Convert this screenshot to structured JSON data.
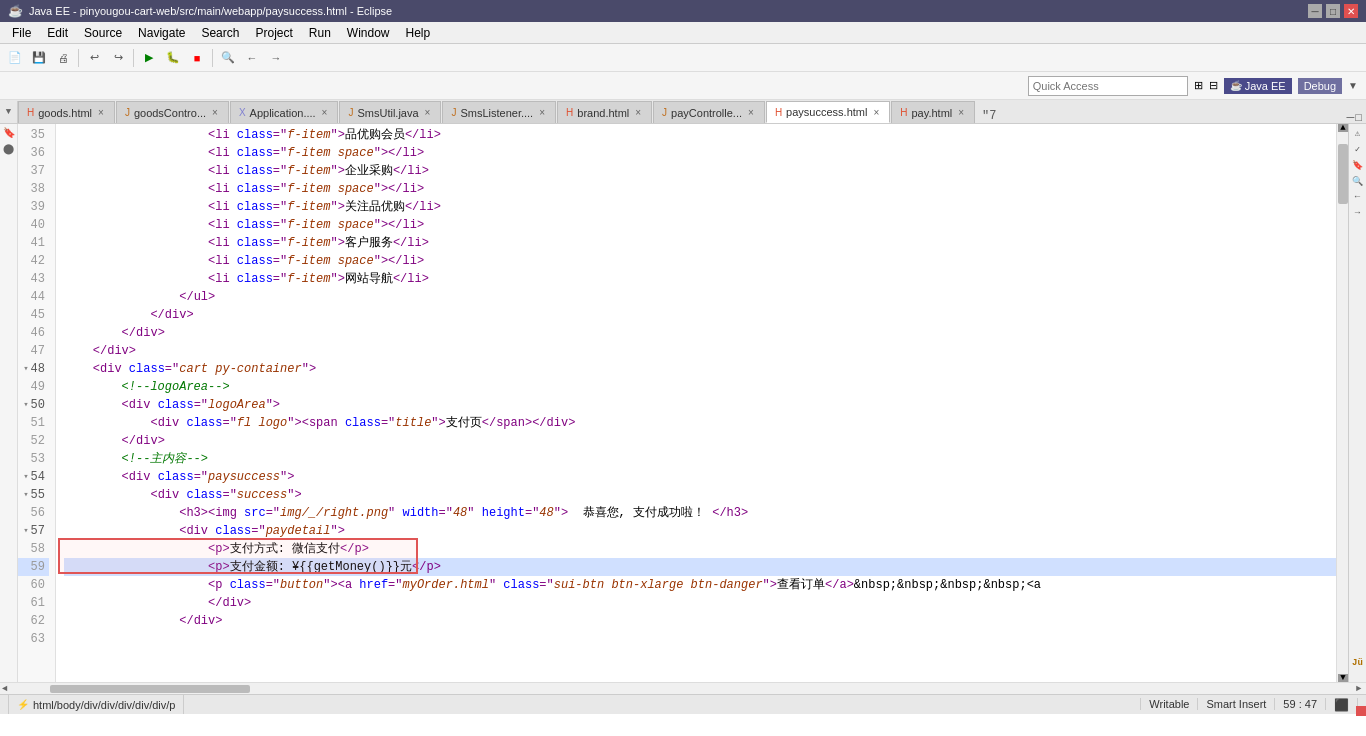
{
  "titleBar": {
    "title": "Java EE - pinyougou-cart-web/src/main/webapp/paysuccess.html - Eclipse",
    "controls": [
      "minimize",
      "maximize",
      "close"
    ]
  },
  "menuBar": {
    "items": [
      "File",
      "Edit",
      "Source",
      "Navigate",
      "Search",
      "Project",
      "Run",
      "Window",
      "Help"
    ]
  },
  "quickAccess": {
    "label": "Quick Access",
    "perspectives": [
      "Java EE",
      "Debug"
    ]
  },
  "tabs": [
    {
      "icon": "html",
      "label": "goods.html",
      "active": false
    },
    {
      "icon": "java",
      "label": "goodsContro...",
      "active": false
    },
    {
      "icon": "xml",
      "label": "Application....",
      "active": false
    },
    {
      "icon": "java",
      "label": "SmsUtil.java",
      "active": false
    },
    {
      "icon": "java",
      "label": "SmsListener....",
      "active": false
    },
    {
      "icon": "html",
      "label": "brand.html",
      "active": false
    },
    {
      "icon": "java",
      "label": "payControlle...",
      "active": false
    },
    {
      "icon": "html",
      "label": "paysuccess.html",
      "active": true
    },
    {
      "icon": "html",
      "label": "pay.html",
      "active": false
    }
  ],
  "code": {
    "lines": [
      {
        "num": 35,
        "fold": false,
        "content": "                    <li class=\"f-item\">品优购会员</li>"
      },
      {
        "num": 36,
        "fold": false,
        "content": "                    <li class=\"f-item space\"></li>"
      },
      {
        "num": 37,
        "fold": false,
        "content": "                    <li class=\"f-item\">企业采购</li>"
      },
      {
        "num": 38,
        "fold": false,
        "content": "                    <li class=\"f-item space\"></li>"
      },
      {
        "num": 39,
        "fold": false,
        "content": "                    <li class=\"f-item\">关注品优购</li>"
      },
      {
        "num": 40,
        "fold": false,
        "content": "                    <li class=\"f-item space\"></li>"
      },
      {
        "num": 41,
        "fold": false,
        "content": "                    <li class=\"f-item\">客户服务</li>"
      },
      {
        "num": 42,
        "fold": false,
        "content": "                    <li class=\"f-item space\"></li>"
      },
      {
        "num": 43,
        "fold": false,
        "content": "                    <li class=\"f-item\">网站导航</li>"
      },
      {
        "num": 44,
        "fold": false,
        "content": "                </ul>"
      },
      {
        "num": 45,
        "fold": false,
        "content": "            </div>"
      },
      {
        "num": 46,
        "fold": false,
        "content": "        </div>"
      },
      {
        "num": 47,
        "fold": false,
        "content": "    </div>"
      },
      {
        "num": 48,
        "fold": true,
        "content": "    <div class=\"cart py-container\">"
      },
      {
        "num": 49,
        "fold": false,
        "content": "        <!--logoArea-->"
      },
      {
        "num": 50,
        "fold": true,
        "content": "        <div class=\"logoArea\">"
      },
      {
        "num": 51,
        "fold": false,
        "content": "            <div class=\"fl logo\"><span class=\"title\">支付页</span></div>"
      },
      {
        "num": 52,
        "fold": false,
        "content": "        </div>"
      },
      {
        "num": 53,
        "fold": false,
        "content": "        <!--主内容-->"
      },
      {
        "num": 54,
        "fold": true,
        "content": "        <div class=\"paysuccess\">"
      },
      {
        "num": 55,
        "fold": true,
        "content": "            <div class=\"success\">"
      },
      {
        "num": 56,
        "fold": false,
        "content": "                <h3><img src=\"img/_/right.png\" width=\"48\" height=\"48\">  恭喜您, 支付成功啦！</h3>"
      },
      {
        "num": 57,
        "fold": true,
        "content": "                <div class=\"paydetail\">"
      },
      {
        "num": 58,
        "fold": false,
        "content": "                    <p>支付方式: 微信支付</p>",
        "selected": false
      },
      {
        "num": 59,
        "fold": false,
        "content": "                    <p>支付金额: ¥{{getMoney()}}元</p>",
        "selected": true,
        "highlighted": true
      },
      {
        "num": 60,
        "fold": false,
        "content": "                    <p class=\"button\"><a href=\"myOrder.html\" class=\"sui-btn btn-xlarge btn-danger\">查看订单</a>&nbsp;&nbsp;&nbsp;&nbsp;&nbsp;<a"
      },
      {
        "num": 61,
        "fold": false,
        "content": "                    </div>"
      },
      {
        "num": 62,
        "fold": false,
        "content": "                </div>"
      },
      {
        "num": 63,
        "fold": false,
        "content": ""
      }
    ]
  },
  "statusBar": {
    "breadcrumb": "html/body/div/div/div/div/div/p",
    "writable": "Writable",
    "insertMode": "Smart Insert",
    "position": "59 : 47"
  }
}
